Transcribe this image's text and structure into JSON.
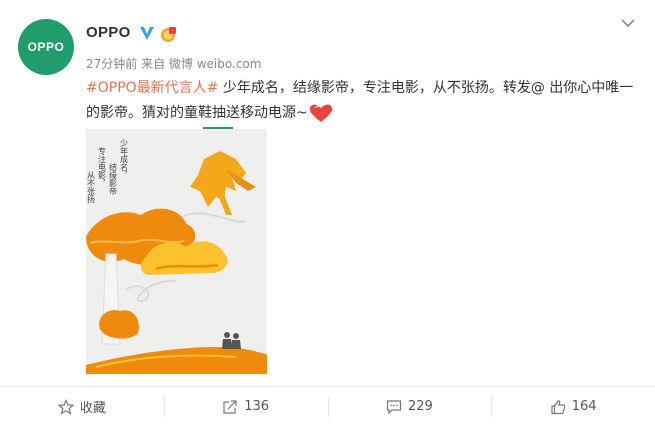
{
  "post": {
    "avatar_text": "OPPO",
    "username": "OPPO",
    "time": "27分钟前",
    "source": "来自 微博 weibo.com",
    "topic": "#OPPO最新代言人#",
    "body": " 少年成名，结缘影帝，专注电影，从不张扬。转发@ 出你心中唯一的影帝。猜对的童鞋抽送移动电源~",
    "image_poem": [
      "少年成名，",
      "结缘影帝",
      "专注电影，",
      "从不张扬"
    ]
  },
  "actions": [
    {
      "label": "收藏",
      "icon": "star-icon"
    },
    {
      "label": "136",
      "icon": "repost-icon"
    },
    {
      "label": "229",
      "icon": "comment-icon"
    },
    {
      "label": "164",
      "icon": "like-icon"
    }
  ],
  "colors": {
    "brand": "#1f9d6d",
    "topic": "#eb7350",
    "verified": "#3b9ee8",
    "heart": "#e8453c"
  }
}
